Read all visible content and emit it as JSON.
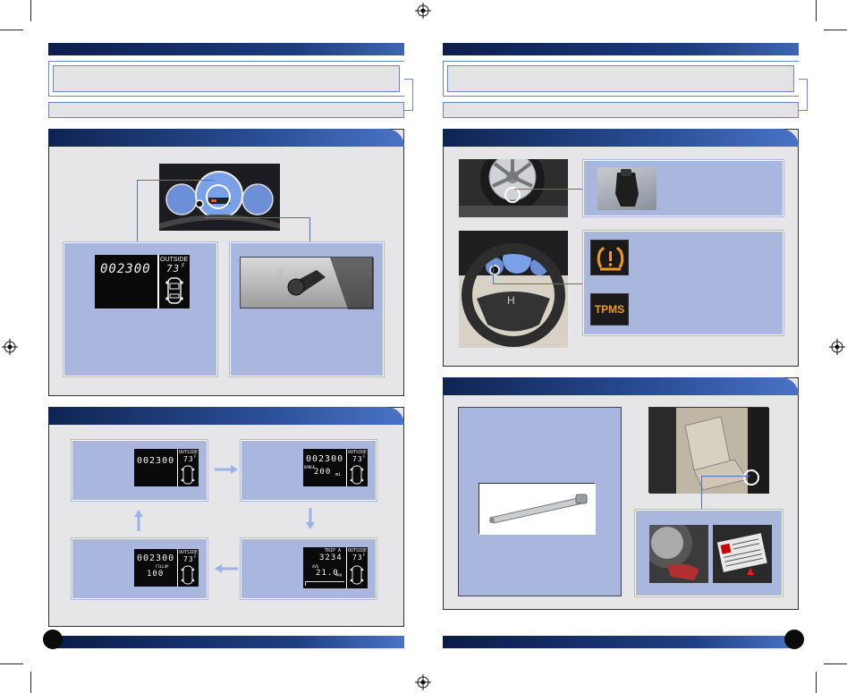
{
  "left_page": {
    "display_modes": {
      "main": {
        "odometer": "002300",
        "outside_label": "OUTSIDE",
        "temp": "73",
        "temp_unit": "F"
      },
      "mode1": {
        "odometer": "002300",
        "outside_label": "OUTSIDE",
        "temp": "73",
        "temp_unit": "F"
      },
      "mode2": {
        "odometer": "002300",
        "outside_label": "OUTSIDE",
        "temp": "73",
        "temp_unit": "F",
        "range_label": "RANGE",
        "range_value": "200",
        "range_unit": "mi"
      },
      "mode3": {
        "trip_label": "TRIP A",
        "trip_value": "3234",
        "mpg_label": "AVG",
        "mpg_value": "21.0",
        "mpg_unit": "mpg",
        "outside_label": "OUTSIDE",
        "temp": "73",
        "temp_unit": "F"
      },
      "mode4": {
        "odometer": "002300",
        "fill_label": "FILLUP",
        "fill_value": "100",
        "outside_label": "OUTSIDE",
        "temp": "73",
        "temp_unit": "F"
      }
    }
  },
  "right_page": {
    "warning_icons": {
      "tpms_text": "TPMS"
    }
  },
  "colors": {
    "header_dark": "#0d1f4a",
    "header_light": "#3f66b2",
    "lavender": "#a9b6dd",
    "warning_amber": "#f29a1f"
  }
}
